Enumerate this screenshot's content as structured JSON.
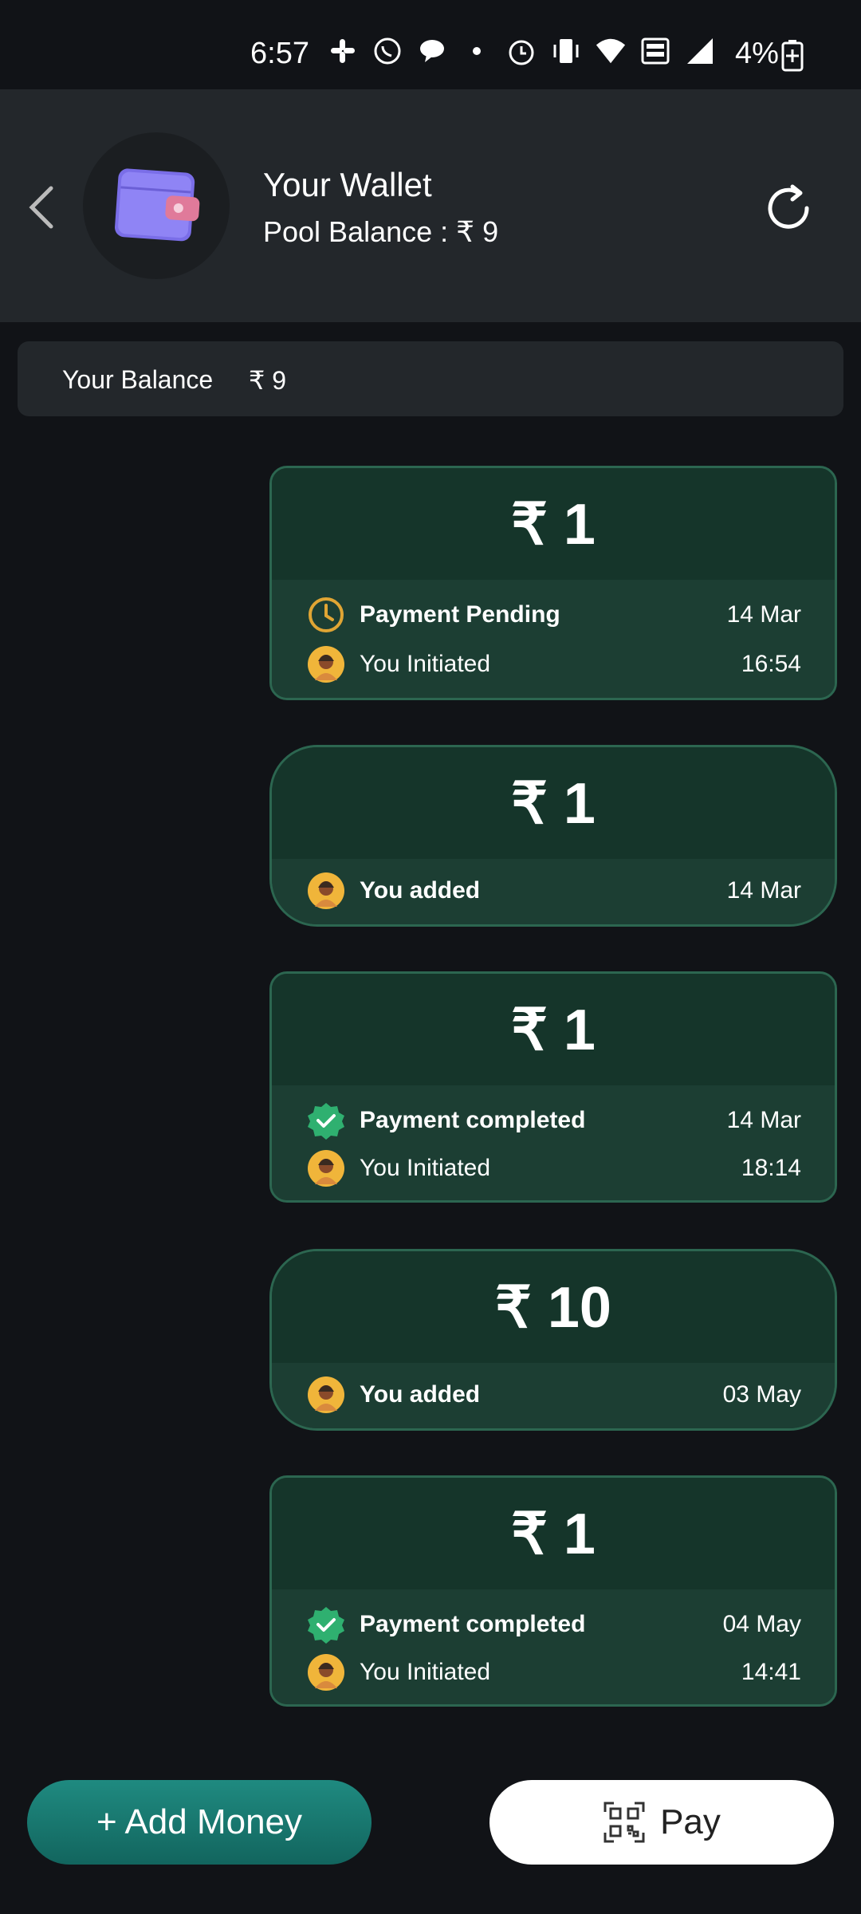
{
  "status_bar": {
    "time": "6:57",
    "battery": "4%",
    "icons": [
      "slack-icon",
      "whatsapp-icon",
      "chat-icon",
      "dot-icon",
      "alarm-icon",
      "vibrate-icon",
      "wifi-icon",
      "volte-icon",
      "signal-icon",
      "battery-icon"
    ]
  },
  "header": {
    "title": "Your Wallet",
    "pool_balance": "Pool Balance :  ₹ 9"
  },
  "balance": {
    "label": "Your Balance",
    "value": "₹ 9"
  },
  "transactions": [
    {
      "amount": "₹ 1",
      "status": "Payment Pending",
      "by": "You Initiated",
      "date": "14 Mar",
      "time": "16:54"
    },
    {
      "amount": "₹ 1",
      "by": "You added",
      "date": "14 Mar"
    },
    {
      "amount": "₹ 1",
      "status": "Payment completed",
      "by": "You Initiated",
      "date": "14 Mar",
      "time": "18:14"
    },
    {
      "amount": "₹ 10",
      "by": "You added",
      "date": "03 May"
    },
    {
      "amount": "₹ 1",
      "status": "Payment completed",
      "by": "You Initiated",
      "date": "04 May",
      "time": "14:41"
    }
  ],
  "actions": {
    "add_money": "+ Add Money",
    "pay": "Pay"
  },
  "colors": {
    "background": "#111317",
    "header": "#23272b",
    "card_border": "#2c6650",
    "pending": "#e0a534",
    "completed": "#2fb070",
    "add_money": "#1a7f76"
  }
}
